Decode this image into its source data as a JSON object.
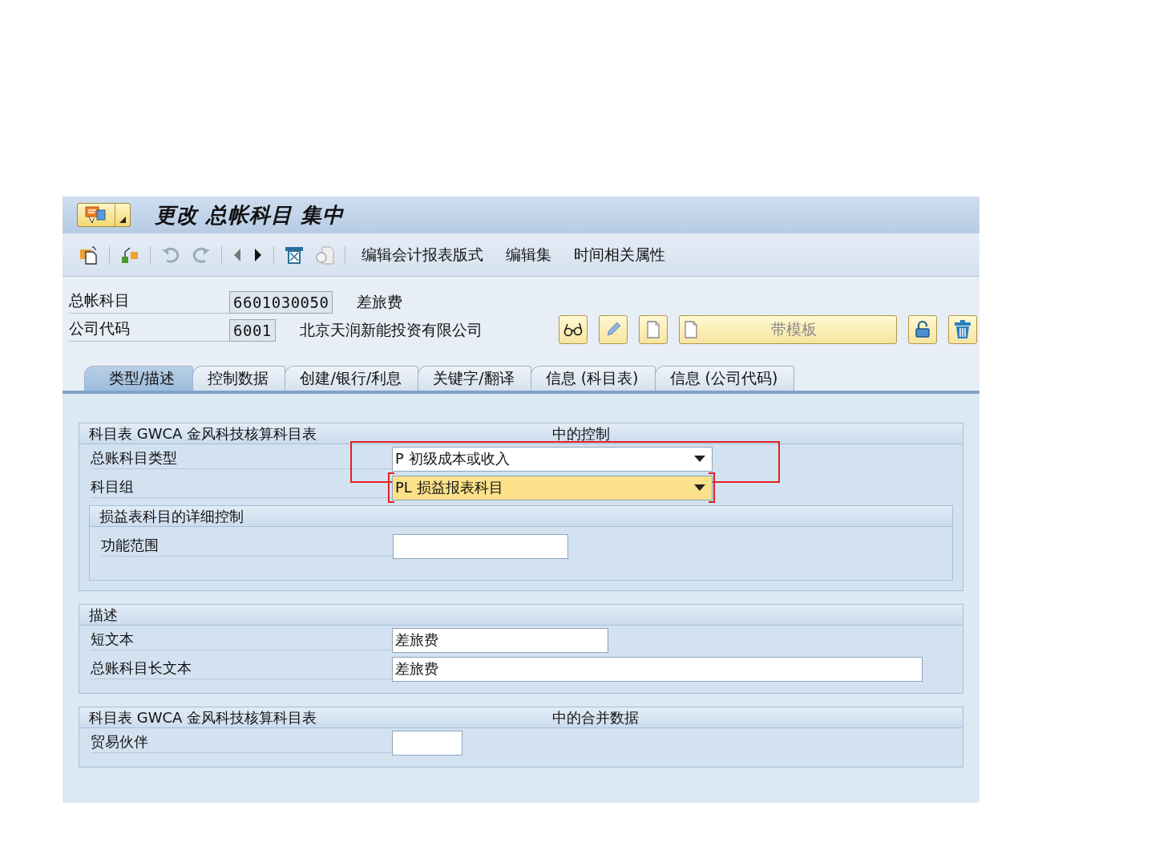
{
  "window": {
    "title": "更改 总帐科目 集中"
  },
  "toolbar": {
    "menu_items": [
      "编辑会计报表版式",
      "编辑集",
      "时间相关属性"
    ]
  },
  "header": {
    "fields": [
      {
        "label": "总帐科目",
        "value": "6601030050",
        "description": "差旅费"
      },
      {
        "label": "公司代码",
        "value": "6001",
        "description": "北京天润新能投资有限公司"
      }
    ],
    "template_button": {
      "label": "带模板",
      "disabled": true
    }
  },
  "tabs": [
    {
      "label": "类型/描述",
      "selected": true
    },
    {
      "label": "控制数据",
      "selected": false
    },
    {
      "label": "创建/银行/利息",
      "selected": false
    },
    {
      "label": "关键字/翻译",
      "selected": false
    },
    {
      "label": "信息 (科目表)",
      "selected": false
    },
    {
      "label": "信息 (公司代码)",
      "selected": false
    }
  ],
  "groups": [
    {
      "title": "科目表 GWCA 金风科技核算科目表",
      "title_suffix": "中的控制",
      "fields": [
        {
          "label": "总账科目类型",
          "kind": "dropdown",
          "value": "P 初级成本或收入",
          "annotated": true,
          "focused": false
        },
        {
          "label": "科目组",
          "kind": "dropdown",
          "value": "PL 损益报表科目",
          "annotated": false,
          "focused": true
        }
      ],
      "subgroup": {
        "title": "损益表科目的详细控制",
        "fields": [
          {
            "label": "功能范围",
            "kind": "input"
          }
        ]
      }
    },
    {
      "title": "描述",
      "fields": [
        {
          "label": "短文本",
          "kind": "input",
          "value": "差旅费"
        },
        {
          "label": "总账科目长文本",
          "kind": "input",
          "value": "差旅费"
        }
      ]
    },
    {
      "title": "科目表 GWCA 金风科技核算科目表",
      "title_suffix": "中的合并数据",
      "fields": [
        {
          "label": "贸易伙伴",
          "kind": "input"
        }
      ]
    }
  ]
}
